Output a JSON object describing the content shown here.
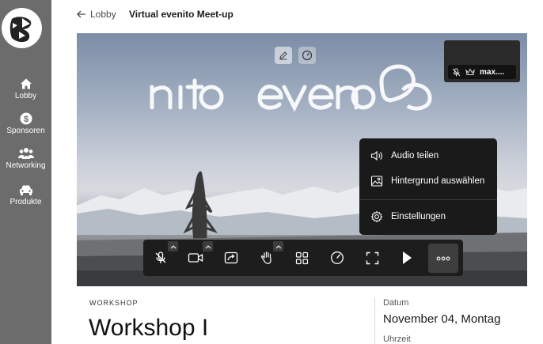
{
  "sidebar": {
    "items": [
      {
        "label": "Lobby",
        "icon": "home-icon"
      },
      {
        "label": "Sponsoren",
        "icon": "dollar-icon"
      },
      {
        "label": "Networking",
        "icon": "people-icon"
      },
      {
        "label": "Produkte",
        "icon": "car-icon"
      }
    ]
  },
  "header": {
    "back_label": "Lobby",
    "title": "Virtual evenito Meet-up"
  },
  "stage": {
    "background_brand": "evenito",
    "self_view_name": "max...."
  },
  "menu": {
    "items": [
      {
        "label": "Audio teilen",
        "icon": "speaker-icon"
      },
      {
        "label": "Hintergrund auswählen",
        "icon": "image-icon"
      },
      {
        "label": "Einstellungen",
        "icon": "gear-icon"
      }
    ]
  },
  "controls": [
    "mic-muted-icon",
    "camera-icon",
    "screen-share-icon",
    "raise-hand-icon",
    "grid-view-icon",
    "speedometer-icon",
    "fullscreen-icon",
    "play-icon",
    "more-icon"
  ],
  "info": {
    "category": "WORKSHOP",
    "title": "Workshop I",
    "date_label": "Datum",
    "date_value": "November 04, Montag",
    "time_label": "Uhrzeit"
  },
  "colors": {
    "sidebar": "#6c6c6c",
    "control_bar": "#1d1d1d",
    "menu": "#1a1a1a"
  }
}
